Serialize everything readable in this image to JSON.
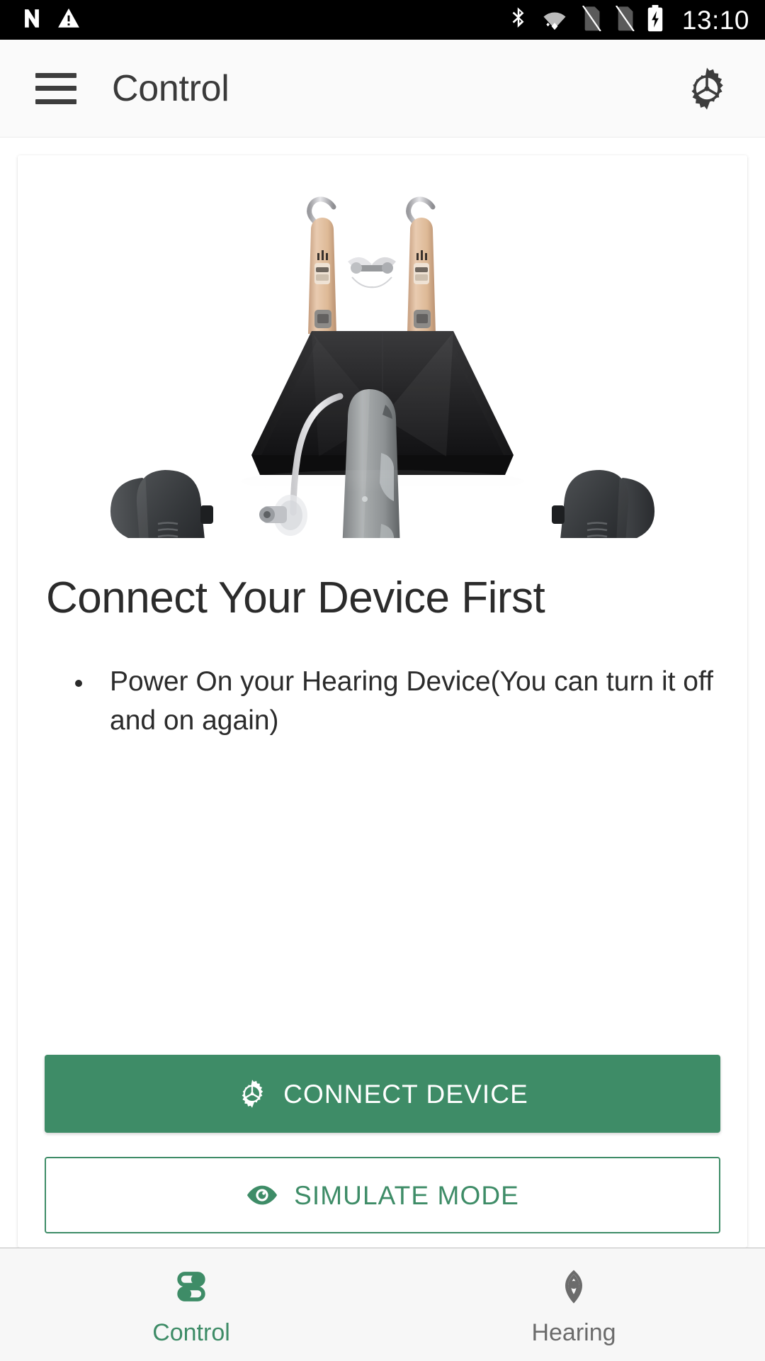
{
  "status_bar": {
    "icons": [
      "nfc-icon",
      "warning-triangle-icon",
      "bluetooth-icon",
      "wifi-icon",
      "sim-card-off-icon",
      "sim-card-off-icon-2",
      "battery-charging-icon"
    ],
    "time": "13:10"
  },
  "app_bar": {
    "menu_icon": "hamburger-menu-icon",
    "title": "Control",
    "action_icon": "gear-icon"
  },
  "card": {
    "hero_image_alt": "hearing-aids-and-charger-product-photo",
    "headline": "Connect Your Device First",
    "bullets": [
      "Power On your Hearing Device(You can turn it off and on again)"
    ],
    "primary_button": {
      "label": "CONNECT DEVICE",
      "icon": "gear-icon"
    },
    "secondary_button": {
      "label": "SIMULATE MODE",
      "icon": "eye-icon"
    }
  },
  "bottom_nav": {
    "items": [
      {
        "label": "Control",
        "icon": "toggle-sliders-icon",
        "active": true
      },
      {
        "label": "Hearing",
        "icon": "signal-waves-icon",
        "active": false
      }
    ]
  },
  "colors": {
    "accent_green": "#3e8c67",
    "status_bar_bg": "#000000",
    "app_bar_bg": "#fafafa",
    "text_primary": "#2b2b2b",
    "text_muted": "#6b6b6b"
  }
}
